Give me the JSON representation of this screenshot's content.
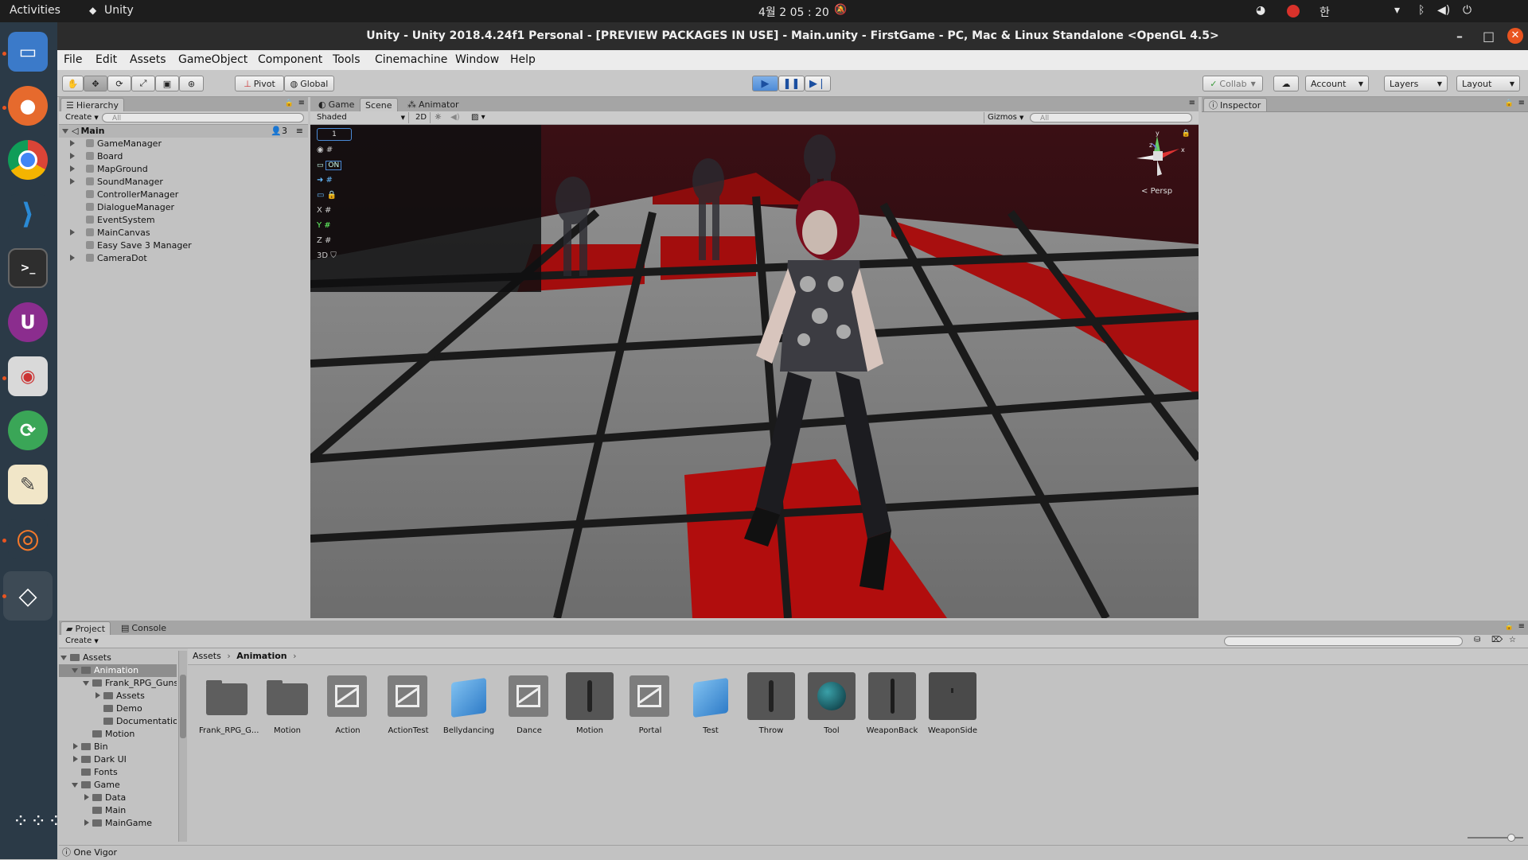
{
  "topbar": {
    "activities": "Activities",
    "app": "Unity",
    "clock": "4월 2  05 : 20",
    "ime": "한"
  },
  "dock": {
    "icons": [
      "files-icon",
      "firefox-icon",
      "chrome-icon",
      "vscode-icon",
      "terminal-icon",
      "unity-hub-icon",
      "screenshot-icon",
      "update-icon",
      "text-editor-icon",
      "blender-icon",
      "unity-icon"
    ]
  },
  "window": {
    "title": "Unity - Unity 2018.4.24f1 Personal - [PREVIEW PACKAGES IN USE] - Main.unity - FirstGame - PC, Mac & Linux Standalone <OpenGL 4.5>"
  },
  "menu": [
    "File",
    "Edit",
    "Assets",
    "GameObject",
    "Component",
    "Tools",
    "Cinemachine",
    "Window",
    "Help"
  ],
  "toolbar": {
    "pivot": "Pivot",
    "global": "Global",
    "collab": "Collab",
    "account": "Account",
    "layers": "Layers",
    "layout": "Layout"
  },
  "hierarchy": {
    "tab": "Hierarchy",
    "create": "Create",
    "search_placeholder": "All",
    "scene": "Main",
    "user_count": "3",
    "items": [
      {
        "label": "GameManager",
        "expandable": true
      },
      {
        "label": "Board",
        "expandable": true
      },
      {
        "label": "MapGround",
        "expandable": true
      },
      {
        "label": "SoundManager",
        "expandable": true
      },
      {
        "label": "ControllerManager",
        "expandable": false
      },
      {
        "label": "DialogueManager",
        "expandable": false
      },
      {
        "label": "EventSystem",
        "expandable": false
      },
      {
        "label": "MainCanvas",
        "expandable": true
      },
      {
        "label": "Easy Save 3 Manager",
        "expandable": false
      },
      {
        "label": "CameraDot",
        "expandable": true
      }
    ]
  },
  "scene_view": {
    "tabs": [
      "Game",
      "Scene",
      "Animator"
    ],
    "active_tab": "Scene",
    "shading": "Shaded",
    "mode_2d": "2D",
    "gizmos": "Gizmos",
    "search_placeholder": "All",
    "persp": "Persp",
    "overlay": [
      "1",
      "",
      "ON",
      "",
      "",
      "X",
      "Y",
      "Z",
      "3D"
    ]
  },
  "inspector": {
    "tab": "Inspector"
  },
  "project": {
    "tabs": [
      "Project",
      "Console"
    ],
    "create": "Create",
    "breadcrumb": [
      "Assets",
      "Animation"
    ],
    "tree": [
      {
        "label": "Assets",
        "depth": 0,
        "open": true,
        "selected": false
      },
      {
        "label": "Animation",
        "depth": 1,
        "open": true,
        "selected": true
      },
      {
        "label": "Frank_RPG_Guns",
        "depth": 2,
        "open": true,
        "selected": false
      },
      {
        "label": "Assets",
        "depth": 3,
        "open": false,
        "expandable": true,
        "selected": false
      },
      {
        "label": "Demo",
        "depth": 3,
        "selected": false
      },
      {
        "label": "Documentatio",
        "depth": 3,
        "selected": false
      },
      {
        "label": "Motion",
        "depth": 2,
        "selected": false
      },
      {
        "label": "Bin",
        "depth": 1,
        "expandable": true,
        "selected": false
      },
      {
        "label": "Dark UI",
        "depth": 1,
        "expandable": true,
        "selected": false
      },
      {
        "label": "Fonts",
        "depth": 1,
        "selected": false
      },
      {
        "label": "Game",
        "depth": 1,
        "open": true,
        "selected": false
      },
      {
        "label": "Data",
        "depth": 2,
        "expandable": true,
        "selected": false
      },
      {
        "label": "Main",
        "depth": 2,
        "selected": false
      },
      {
        "label": "MainGame",
        "depth": 2,
        "expandable": true,
        "selected": false
      }
    ],
    "assets": [
      {
        "label": "Frank_RPG_G...",
        "kind": "folder"
      },
      {
        "label": "Motion",
        "kind": "folder"
      },
      {
        "label": "Action",
        "kind": "controller"
      },
      {
        "label": "ActionTest",
        "kind": "controller"
      },
      {
        "label": "Bellydancing",
        "kind": "model"
      },
      {
        "label": "Dance",
        "kind": "controller"
      },
      {
        "label": "Motion",
        "kind": "clip"
      },
      {
        "label": "Portal",
        "kind": "controller"
      },
      {
        "label": "Test",
        "kind": "model"
      },
      {
        "label": "Throw",
        "kind": "clip"
      },
      {
        "label": "Tool",
        "kind": "sphere"
      },
      {
        "label": "WeaponBack",
        "kind": "pose"
      },
      {
        "label": "WeaponSide",
        "kind": "pose-dark"
      }
    ]
  },
  "status": {
    "text": "One Vigor"
  }
}
